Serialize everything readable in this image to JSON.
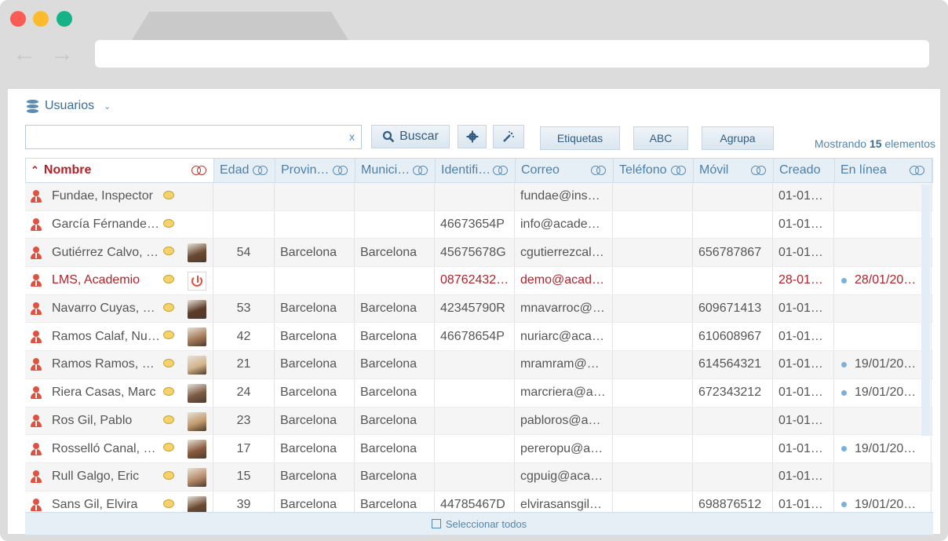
{
  "module": {
    "title": "Usuarios"
  },
  "toolbar": {
    "search_value": "",
    "clear": "x",
    "buscar": "Buscar",
    "etiquetas": "Etiquetas",
    "abc": "ABC",
    "agrupa": "Agrupa",
    "count_prefix": "Mostrando",
    "count_value": "15",
    "count_suffix": "elementos"
  },
  "columns": [
    "Nombre",
    "Edad",
    "Provin…",
    "Munici…",
    "Identifi…",
    "Correo",
    "Teléfono",
    "Móvil",
    "Creado",
    "En línea"
  ],
  "rows": [
    {
      "nombre": "Fundae, Inspector",
      "edad": "",
      "provincia": "",
      "municipio": "",
      "id": "",
      "correo": "fundae@ins…",
      "telefono": "",
      "movil": "",
      "creado": "01-01…",
      "online": "",
      "avatar": "none"
    },
    {
      "nombre": "García Férnande…",
      "edad": "",
      "provincia": "",
      "municipio": "",
      "id": "46673654P",
      "correo": "info@acade…",
      "telefono": "",
      "movil": "",
      "creado": "01-01…",
      "online": "",
      "avatar": "none"
    },
    {
      "nombre": "Gutiérrez Calvo, …",
      "edad": "54",
      "provincia": "Barcelona",
      "municipio": "Barcelona",
      "id": "45675678G",
      "correo": "cgutierrezcal…",
      "telefono": "",
      "movil": "656787867",
      "creado": "01-01…",
      "online": "",
      "avatar": "photo"
    },
    {
      "nombre": "LMS, Academio",
      "edad": "",
      "provincia": "",
      "municipio": "",
      "id": "08762432…",
      "correo": "demo@acad…",
      "telefono": "",
      "movil": "",
      "creado": "28-01…",
      "online": "28/01/20…",
      "avatar": "power"
    },
    {
      "nombre": "Navarro Cuyas, …",
      "edad": "53",
      "provincia": "Barcelona",
      "municipio": "Barcelona",
      "id": "42345790R",
      "correo": "mnavarroc@…",
      "telefono": "",
      "movil": "609671413",
      "creado": "01-01…",
      "online": "",
      "avatar": "photo"
    },
    {
      "nombre": "Ramos Calaf, Nu…",
      "edad": "42",
      "provincia": "Barcelona",
      "municipio": "Barcelona",
      "id": "46678654P",
      "correo": "nuriarc@aca…",
      "telefono": "",
      "movil": "610608967",
      "creado": "01-01…",
      "online": "",
      "avatar": "photo"
    },
    {
      "nombre": "Ramos Ramos, …",
      "edad": "21",
      "provincia": "Barcelona",
      "municipio": "Barcelona",
      "id": "",
      "correo": "mramram@…",
      "telefono": "",
      "movil": "614564321",
      "creado": "01-01…",
      "online": "19/01/20…",
      "avatar": "photo"
    },
    {
      "nombre": "Riera Casas, Marc",
      "edad": "24",
      "provincia": "Barcelona",
      "municipio": "Barcelona",
      "id": "",
      "correo": "marcriera@a…",
      "telefono": "",
      "movil": "672343212",
      "creado": "01-01…",
      "online": "19/01/20…",
      "avatar": "photo"
    },
    {
      "nombre": "Ros Gil, Pablo",
      "edad": "23",
      "provincia": "Barcelona",
      "municipio": "Barcelona",
      "id": "",
      "correo": "pabloros@a…",
      "telefono": "",
      "movil": "",
      "creado": "01-01…",
      "online": "",
      "avatar": "photo"
    },
    {
      "nombre": "Rosselló Canal, P…",
      "edad": "17",
      "provincia": "Barcelona",
      "municipio": "Barcelona",
      "id": "",
      "correo": "pereropu@a…",
      "telefono": "",
      "movil": "",
      "creado": "01-01…",
      "online": "19/01/20…",
      "avatar": "photo"
    },
    {
      "nombre": "Rull Galgo, Eric",
      "edad": "15",
      "provincia": "Barcelona",
      "municipio": "Barcelona",
      "id": "",
      "correo": "cgpuig@aca…",
      "telefono": "",
      "movil": "",
      "creado": "01-01…",
      "online": "",
      "avatar": "photo"
    },
    {
      "nombre": "Sans Gil, Elvira",
      "edad": "39",
      "provincia": "Barcelona",
      "municipio": "Barcelona",
      "id": "44785467D",
      "correo": "elvirasansgil…",
      "telefono": "",
      "movil": "698876512",
      "creado": "01-01…",
      "online": "19/01/20…",
      "avatar": "photo"
    }
  ],
  "footer": {
    "select_all": "Seleccionar todos"
  }
}
